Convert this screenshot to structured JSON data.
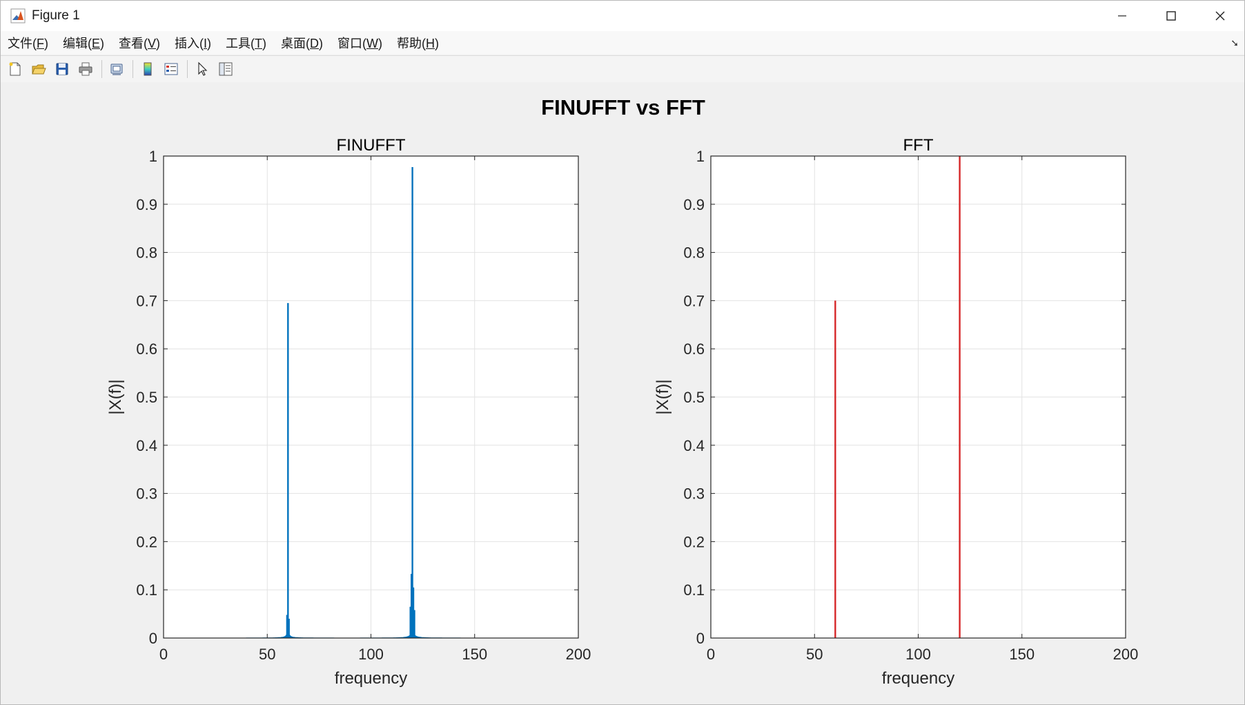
{
  "window": {
    "title": "Figure 1",
    "minimize": "—",
    "maximize": "☐",
    "close": "✕"
  },
  "menu": [
    {
      "label": "文件(",
      "key": "F",
      "end": ")"
    },
    {
      "label": "编辑(",
      "key": "E",
      "end": ")"
    },
    {
      "label": "查看(",
      "key": "V",
      "end": ")"
    },
    {
      "label": "插入(",
      "key": "I",
      "end": ")"
    },
    {
      "label": "工具(",
      "key": "T",
      "end": ")"
    },
    {
      "label": "桌面(",
      "key": "D",
      "end": ")"
    },
    {
      "label": "窗口(",
      "key": "W",
      "end": ")"
    },
    {
      "label": "帮助(",
      "key": "H",
      "end": ")"
    }
  ],
  "toolbar": {
    "icons": [
      "new-figure-icon",
      "open-file-icon",
      "save-icon",
      "print-icon",
      "print-preview-icon",
      "colorbar-icon",
      "legend-icon",
      "pointer-icon",
      "property-inspector-icon"
    ]
  },
  "figure": {
    "sgtitle": "FINUFFT vs FFT"
  },
  "chart_data": [
    {
      "type": "line",
      "title": "FINUFFT",
      "xlabel": "frequency",
      "ylabel": "|X(f)|",
      "xlim": [
        0,
        200
      ],
      "ylim": [
        0,
        1
      ],
      "xticks": [
        0,
        50,
        100,
        150,
        200
      ],
      "yticks": [
        0,
        0.1,
        0.2,
        0.3,
        0.4,
        0.5,
        0.6,
        0.7,
        0.8,
        0.9,
        1
      ],
      "grid": true,
      "color": "#0072BD",
      "series": [
        {
          "peaks": [
            {
              "x": 60,
              "y": 0.695
            },
            {
              "x": 120,
              "y": 0.977
            }
          ],
          "sidelobes": [
            {
              "x": 59.5,
              "y": 0.048
            },
            {
              "x": 60.5,
              "y": 0.04
            },
            {
              "x": 119.5,
              "y": 0.133
            },
            {
              "x": 120.5,
              "y": 0.105
            },
            {
              "x": 119,
              "y": 0.065
            },
            {
              "x": 121,
              "y": 0.058
            }
          ],
          "floor_scale": 0.5
        }
      ]
    },
    {
      "type": "line",
      "title": "FFT",
      "xlabel": "frequency",
      "ylabel": "|X(f)|",
      "xlim": [
        0,
        200
      ],
      "ylim": [
        0,
        1
      ],
      "xticks": [
        0,
        50,
        100,
        150,
        200
      ],
      "yticks": [
        0,
        0.1,
        0.2,
        0.3,
        0.4,
        0.5,
        0.6,
        0.7,
        0.8,
        0.9,
        1
      ],
      "grid": true,
      "color": "#D62728",
      "series": [
        {
          "peaks": [
            {
              "x": 60,
              "y": 0.7
            },
            {
              "x": 120,
              "y": 1.0
            }
          ]
        }
      ]
    }
  ]
}
